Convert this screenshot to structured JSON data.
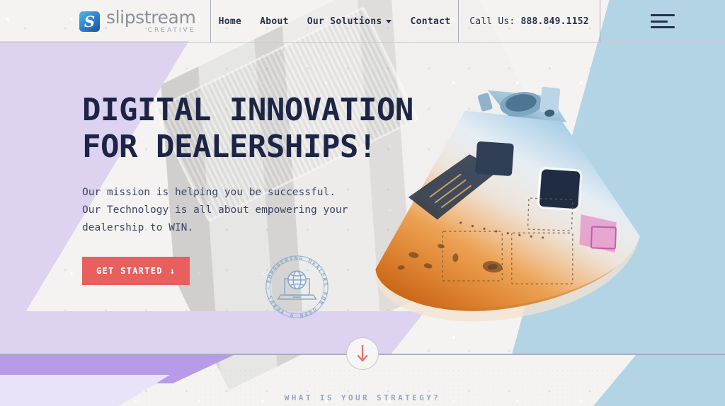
{
  "brand": {
    "name": "slipstream",
    "tagline": "CREATIVE",
    "logo_icon": "slipstream-s-logo",
    "logo_glyph": "S"
  },
  "header": {
    "nav": [
      {
        "label": "Home",
        "has_dropdown": false
      },
      {
        "label": "About",
        "has_dropdown": false
      },
      {
        "label": "Our Solutions",
        "has_dropdown": true
      },
      {
        "label": "Contact",
        "has_dropdown": false
      }
    ],
    "call_us": {
      "label": "Call Us: ",
      "number": "888.849.1152"
    },
    "menu_icon": "hamburger-menu-icon"
  },
  "hero": {
    "headline_line1": "DIGITAL INNOVATION",
    "headline_line2": "FOR DEALERSHIPS!",
    "paragraph_line1": "Our mission is helping you be successful.",
    "paragraph_line2": "Our Technology is all about empowering your",
    "paragraph_line3": "dealership to WIN.",
    "cta_label": "GET STARTED",
    "cta_arrow": "↓"
  },
  "badge": {
    "text": "EMPOWERING DEALERS FOR OVER 9 YEARS ·",
    "icon": "laptop-globe-icon"
  },
  "scroll_indicator": {
    "icon": "arrow-down-icon"
  },
  "next_section": {
    "strapline": "WHAT IS YOUR STRATEGY?"
  },
  "colors": {
    "headline_navy": "#1d2546",
    "cta_coral": "#e8605d",
    "lavender": "#ddd2f0",
    "purple": "#b79ae8",
    "sky_blue": "#b3d4e5",
    "paper": "#f4f3f1",
    "strapline_blue": "#8fa7cf",
    "badge_blue": "#8fb3d4"
  }
}
